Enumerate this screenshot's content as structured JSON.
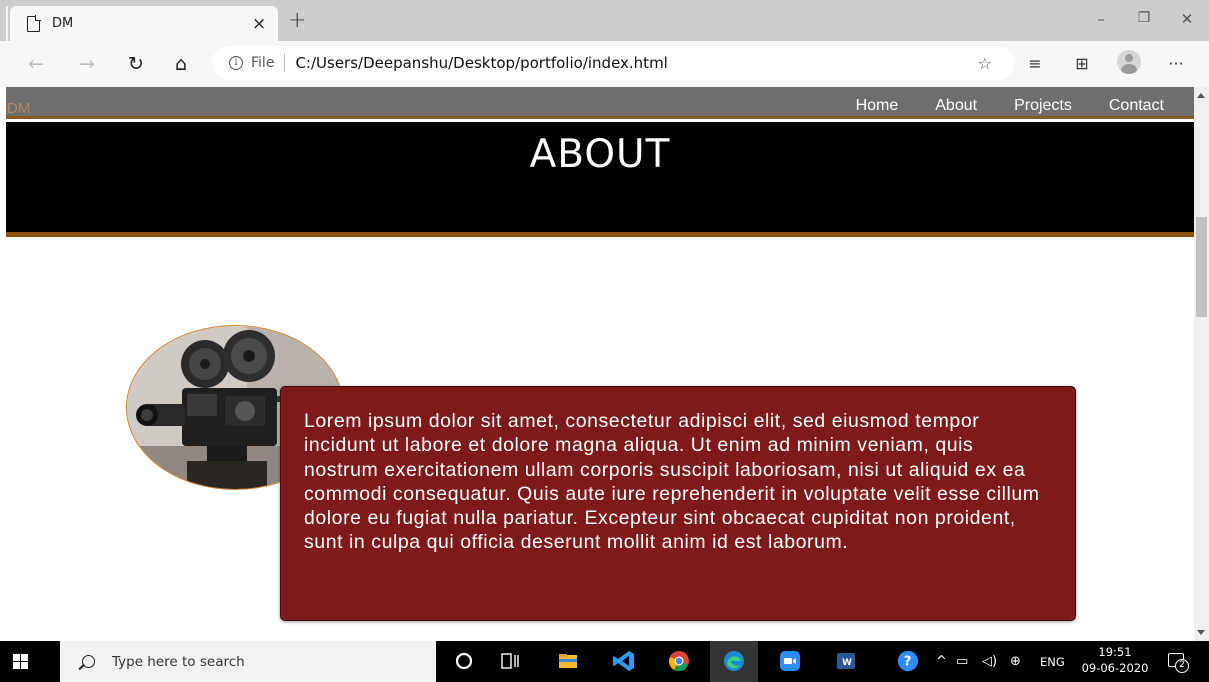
{
  "browser": {
    "tab_title": "DM",
    "tab_close": "×",
    "new_tab": "+",
    "minimize": "–",
    "restore": "❐",
    "close": "✕",
    "address_file_label": "File",
    "url": "C:/Users/Deepanshu/Desktop/portfolio/index.html",
    "more_menu": "···"
  },
  "site": {
    "logo": "DM",
    "nav": [
      "Home",
      "About",
      "Projects",
      "Contact"
    ],
    "heading": "ABOUT",
    "about_text": "Lorem ipsum dolor sit amet, consectetur adipisci elit, sed eiusmod tempor incidunt ut labore et dolore magna aliqua. Ut enim ad minim veniam, quis nostrum exercitationem ullam corporis suscipit laboriosam, nisi ut aliquid ex ea commodi consequatur. Quis aute iure reprehenderit in voluptate velit esse cillum dolore eu fugiat nulla pariatur. Excepteur sint obcaecat cupiditat non proident, sunt in culpa qui officia deserunt mollit anim id est laborum.",
    "colors": {
      "nav_bg": "#6e6e6e",
      "accent_border": "#8a5210",
      "hero_bg": "#000000",
      "text_box_bg": "#7e1a1a"
    }
  },
  "taskbar": {
    "search_placeholder": "Type here to search",
    "apps": [
      "cortana-icon",
      "task-view-icon",
      "file-explorer-icon",
      "vscode-icon",
      "chrome-icon",
      "edge-icon",
      "zoom-icon",
      "word-icon"
    ],
    "language": "ENG",
    "time": "19:51",
    "date": "09-06-2020",
    "notification_count": "2"
  }
}
